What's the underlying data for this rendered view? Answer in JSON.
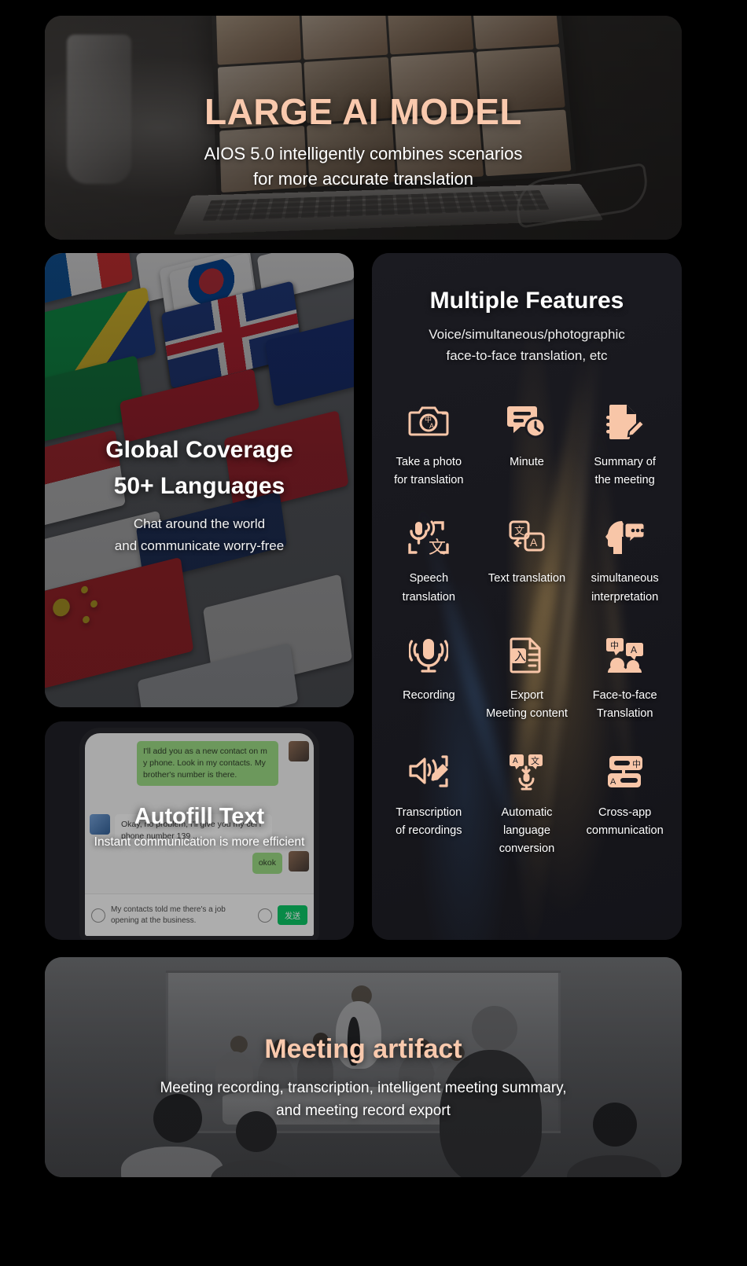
{
  "theme": {
    "page_bg": "#000000",
    "card_bg": "#1a1a20",
    "accent": "#f9c9ad",
    "icon_color": "#f8c6a8",
    "text_primary": "#ffffff"
  },
  "hero": {
    "title": "LARGE AI MODEL",
    "subtitle_line1": "AIOS 5.0 intelligently combines scenarios",
    "subtitle_line2": "for more accurate translation"
  },
  "coverage": {
    "title_line1": "Global Coverage",
    "title_line2": "50+ Languages",
    "subtitle_line1": "Chat around the world",
    "subtitle_line2": "and communicate worry-free"
  },
  "autofill": {
    "title": "Autofill Text",
    "subtitle": "Instant communication is more efficient",
    "chat": {
      "bubble1": "I'll add you as a new contact on m\ny phone.\nLook in my contacts. My brother's\nnumber is there.",
      "bubble2": "Okay, no problem, I'll give you my cel\nl phone number 139 ...",
      "bubble3": "okok",
      "input_text": "My contacts told me there's a job\nopening at the business.",
      "send_label": "发送"
    }
  },
  "features": {
    "title": "Multiple Features",
    "subtitle_line1": "Voice/simultaneous/photographic",
    "subtitle_line2": "face-to-face translation, etc",
    "items": [
      {
        "icon": "camera-translate-icon",
        "label": "Take a photo\nfor translation"
      },
      {
        "icon": "minute-clock-icon",
        "label": "Minute"
      },
      {
        "icon": "document-edit-icon",
        "label": "Summary of\nthe meeting"
      },
      {
        "icon": "mic-character-icon",
        "label": "Speech\ntranslation"
      },
      {
        "icon": "text-translate-icon",
        "label": "Text translation"
      },
      {
        "icon": "head-speech-bubble-icon",
        "label": "simultaneous\ninterpretation"
      },
      {
        "icon": "microphone-waves-icon",
        "label": "Recording"
      },
      {
        "icon": "pdf-export-icon",
        "label": "Export\nMeeting content"
      },
      {
        "icon": "two-heads-translate-icon",
        "label": "Face-to-face\nTranslation"
      },
      {
        "icon": "speaker-pencil-icon",
        "label": "Transcription\nof recordings"
      },
      {
        "icon": "auto-language-mic-icon",
        "label": "Automatic\nlanguage conversion"
      },
      {
        "icon": "cross-app-chat-icon",
        "label": "Cross-app\ncommunication"
      }
    ]
  },
  "meeting": {
    "title": "Meeting artifact",
    "subtitle_line1": "Meeting recording, transcription, intelligent meeting summary,",
    "subtitle_line2": "and meeting record export"
  }
}
